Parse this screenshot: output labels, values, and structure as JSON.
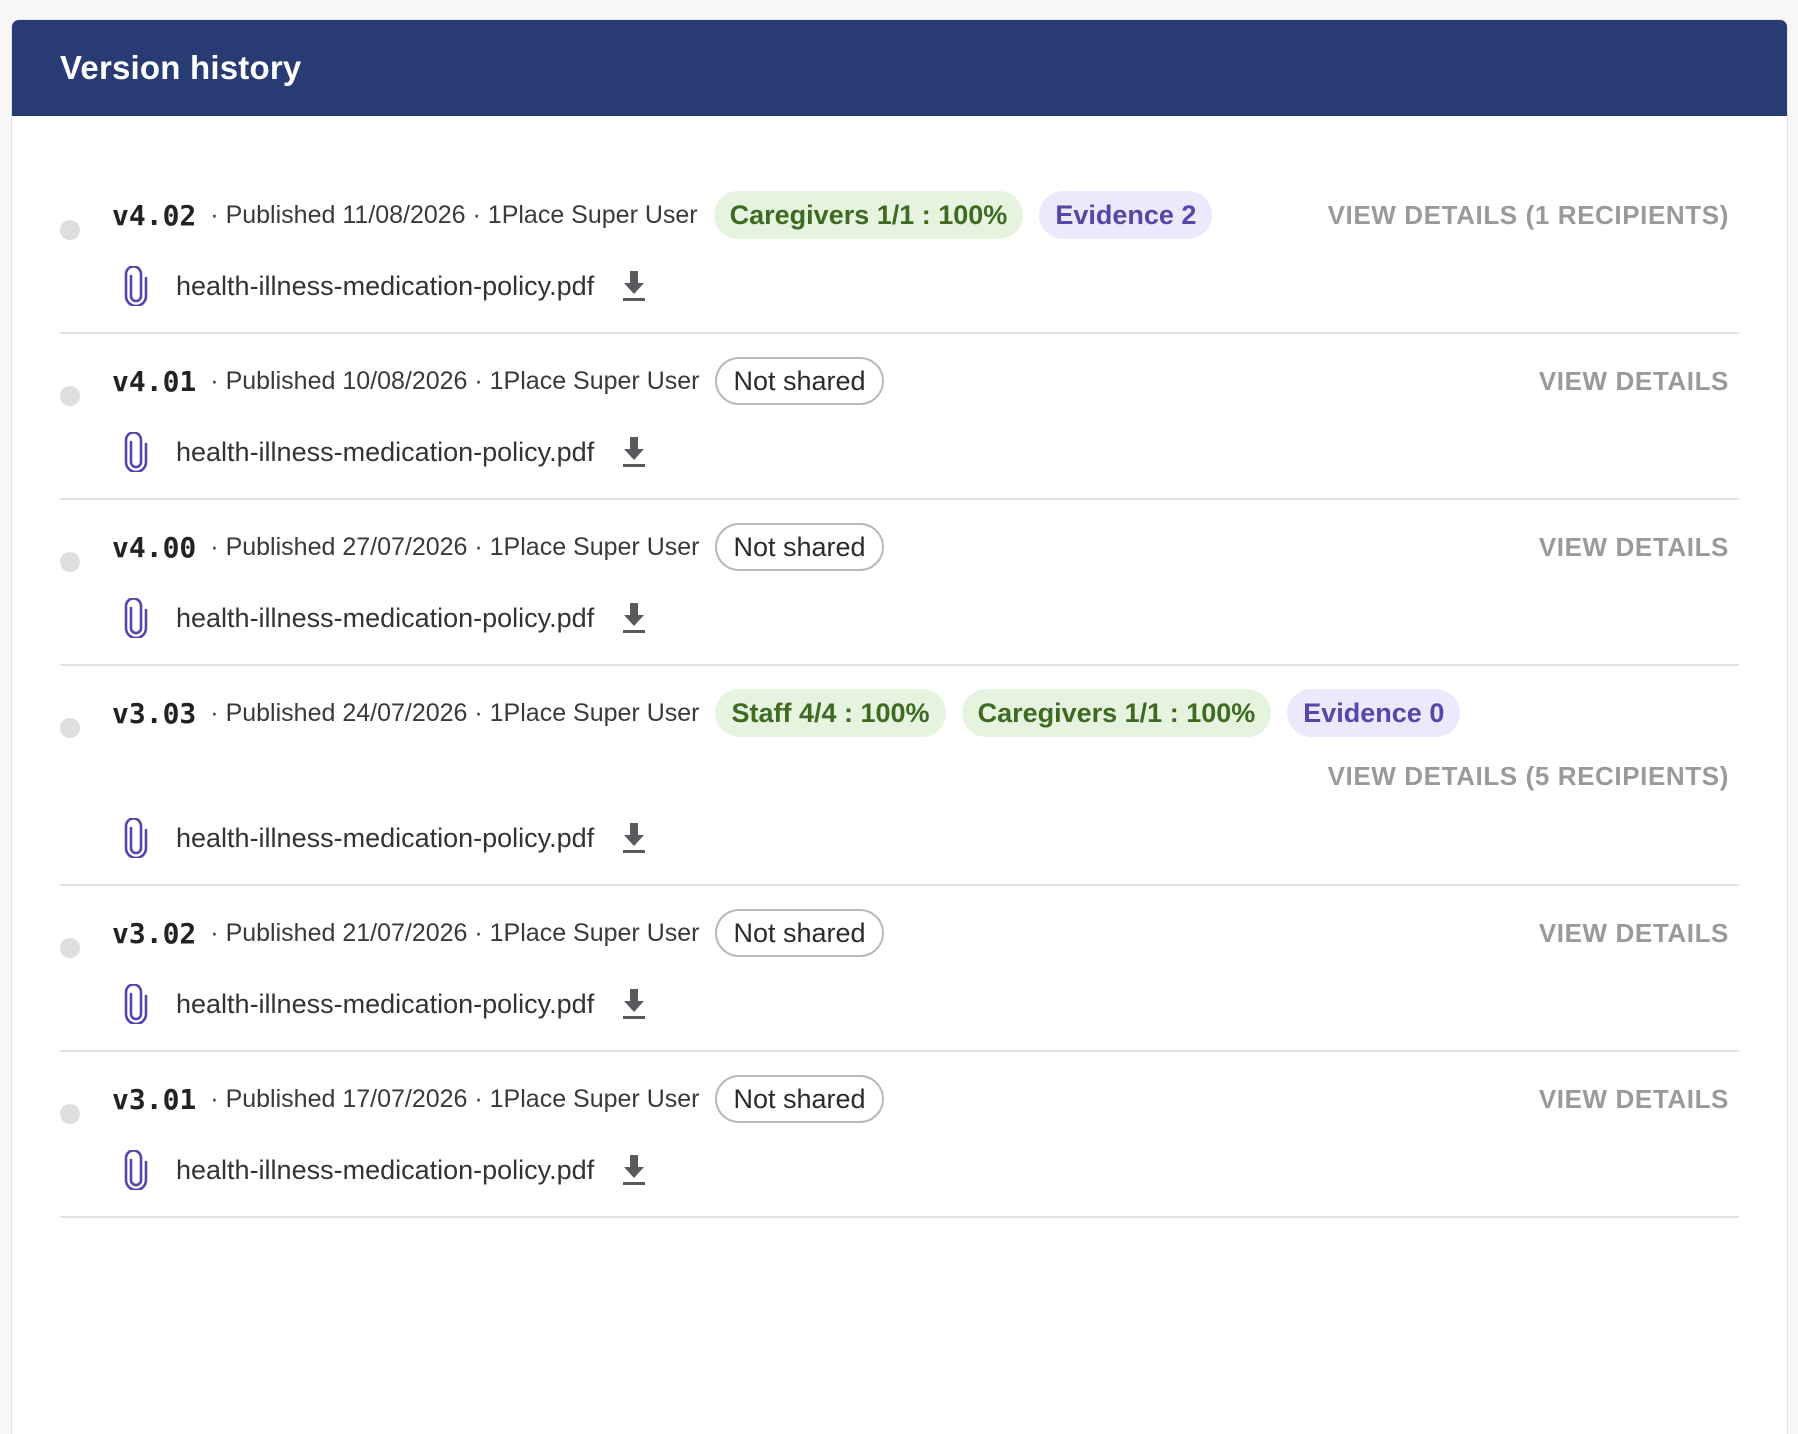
{
  "panel": {
    "title": "Version history"
  },
  "versions": [
    {
      "version": "v4.02",
      "meta": "· Published 11/08/2026 · 1Place Super User",
      "badges": [
        {
          "text": "Caregivers 1/1 : 100%",
          "kind": "green"
        },
        {
          "text": "Evidence 2",
          "kind": "purple"
        }
      ],
      "details": "VIEW DETAILS (1 RECIPIENTS)",
      "file": "health-illness-medication-policy.pdf"
    },
    {
      "version": "v4.01",
      "meta": "· Published 10/08/2026 · 1Place Super User",
      "badges": [
        {
          "text": "Not shared",
          "kind": "outline"
        }
      ],
      "details": "VIEW DETAILS",
      "file": "health-illness-medication-policy.pdf"
    },
    {
      "version": "v4.00",
      "meta": "· Published 27/07/2026 · 1Place Super User",
      "badges": [
        {
          "text": "Not shared",
          "kind": "outline"
        }
      ],
      "details": "VIEW DETAILS",
      "file": "health-illness-medication-policy.pdf"
    },
    {
      "version": "v3.03",
      "meta": "· Published 24/07/2026 · 1Place Super User",
      "badges": [
        {
          "text": "Staff 4/4 : 100%",
          "kind": "green"
        },
        {
          "text": "Caregivers 1/1 : 100%",
          "kind": "green"
        },
        {
          "text": "Evidence 0",
          "kind": "purple"
        }
      ],
      "details": "VIEW DETAILS (5 RECIPIENTS)",
      "file": "health-illness-medication-policy.pdf"
    },
    {
      "version": "v3.02",
      "meta": "· Published 21/07/2026 · 1Place Super User",
      "badges": [
        {
          "text": "Not shared",
          "kind": "outline"
        }
      ],
      "details": "VIEW DETAILS",
      "file": "health-illness-medication-policy.pdf"
    },
    {
      "version": "v3.01",
      "meta": "· Published 17/07/2026 · 1Place Super User",
      "badges": [
        {
          "text": "Not shared",
          "kind": "outline"
        }
      ],
      "details": "VIEW DETAILS",
      "file": "health-illness-medication-policy.pdf"
    }
  ],
  "colors": {
    "header_bg": "#283b75",
    "badge_green_bg": "#e6f4df",
    "badge_green_text": "#3f6a22",
    "badge_purple_bg": "#ebe9fb",
    "badge_purple_text": "#5347a7",
    "clip_icon": "#5347a7"
  },
  "icons": {
    "attachment": "paperclip-icon",
    "download": "download-icon",
    "status": "status-dot-icon"
  }
}
